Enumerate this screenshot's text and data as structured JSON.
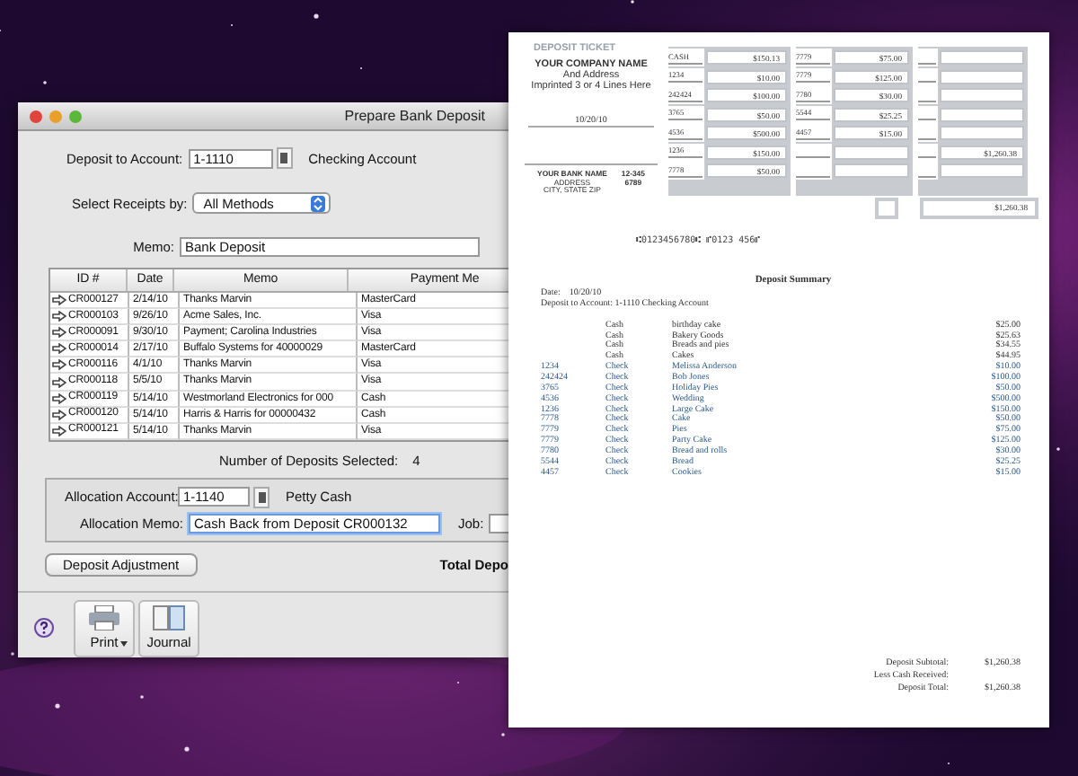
{
  "window": {
    "title": "Prepare Bank Deposit"
  },
  "deposit_to": {
    "label": "Deposit to Account:",
    "value": "1-1110",
    "account_name": "Checking Account"
  },
  "select_receipts": {
    "label": "Select Receipts by:",
    "value": "All Methods"
  },
  "memo": {
    "label": "Memo:",
    "value": "Bank Deposit"
  },
  "table": {
    "columns": [
      "ID #",
      "Date",
      "Memo",
      "Payment Me"
    ],
    "rows": [
      {
        "id": "CR000127",
        "date": "2/14/10",
        "memo": "Thanks Marvin",
        "payment": "MasterCard"
      },
      {
        "id": "CR000103",
        "date": "9/26/10",
        "memo": "Acme Sales, Inc.",
        "payment": "Visa"
      },
      {
        "id": "CR000091",
        "date": "9/30/10",
        "memo": "Payment; Carolina Industries",
        "payment": "Visa"
      },
      {
        "id": "CR000014",
        "date": "2/17/10",
        "memo": "Buffalo Systems for 40000029",
        "payment": "MasterCard"
      },
      {
        "id": "CR000116",
        "date": "4/1/10",
        "memo": "Thanks Marvin",
        "payment": "Visa"
      },
      {
        "id": "CR000118",
        "date": "5/5/10",
        "memo": "Thanks Marvin",
        "payment": "Visa"
      },
      {
        "id": "CR000119",
        "date": "5/14/10",
        "memo": "Westmorland Electronics for 000",
        "payment": "Cash"
      },
      {
        "id": "CR000120",
        "date": "5/14/10",
        "memo": "Harris & Harris for 00000432",
        "payment": "Cash"
      },
      {
        "id": "CR000121",
        "date": "5/14/10",
        "memo": "Thanks Marvin",
        "payment": "Visa"
      }
    ]
  },
  "deposits_selected": {
    "label": "Number of Deposits Selected:",
    "value": "4"
  },
  "allocation": {
    "account_label": "Allocation Account:",
    "account": "1-1140",
    "account_name": "Petty Cash",
    "memo_label": "Allocation Memo:",
    "memo": "Cash Back from Deposit CR000132",
    "job_label": "Job:"
  },
  "deposit_adjustment_button": "Deposit Adjustment",
  "total_label": "Total Depo",
  "toolbar": [
    {
      "label": "Print",
      "kind": "print"
    },
    {
      "label": "Journal",
      "kind": "journal"
    }
  ],
  "ticket": {
    "title": "DEPOSIT TICKET",
    "company": [
      "YOUR COMPANY NAME",
      "And Address",
      "Imprinted 3 or 4 Lines Here"
    ],
    "date": "10/20/10",
    "bank": [
      "YOUR BANK NAME",
      "ADDRESS",
      "CITY, STATE ZIP"
    ],
    "routing": [
      "12-345",
      "6789"
    ],
    "columns": [
      [
        {
          "ref": "CASH",
          "amount": "$150.13"
        },
        {
          "ref": "1234",
          "amount": "$10.00"
        },
        {
          "ref": "242424",
          "amount": "$100.00"
        },
        {
          "ref": "3765",
          "amount": "$50.00"
        },
        {
          "ref": "4536",
          "amount": "$500.00"
        },
        {
          "ref": "1236",
          "amount": "$150.00"
        },
        {
          "ref": "7778",
          "amount": "$50.00"
        }
      ],
      [
        {
          "ref": "7779",
          "amount": "$75.00"
        },
        {
          "ref": "7779",
          "amount": "$125.00"
        },
        {
          "ref": "7780",
          "amount": "$30.00"
        },
        {
          "ref": "5544",
          "amount": "$25.25"
        },
        {
          "ref": "4457",
          "amount": "$15.00"
        }
      ]
    ],
    "subtotal": "$1,260.38",
    "total": "$1,260.38",
    "micr": "⑆0123456780⑆ ⑈0123 456⑈"
  },
  "summary": {
    "title": "Deposit Summary",
    "date_label": "Date:",
    "date": "10/20/10",
    "account_line": "Deposit to Account: 1-1110  Checking Account",
    "rows": [
      {
        "kind": "cash",
        "type": "Cash",
        "memo": "birthday cake",
        "amount": "$25.00"
      },
      {
        "kind": "cash",
        "type": "Cash",
        "memo": "Bakery Goods",
        "amount": "$25.63"
      },
      {
        "kind": "cash",
        "type": "Cash",
        "memo": "Breads and pies",
        "amount": "$34.55"
      },
      {
        "kind": "cash",
        "type": "Cash",
        "memo": "Cakes",
        "amount": "$44.95"
      },
      {
        "kind": "check",
        "ref": "1234",
        "type": "Check",
        "memo": "Melissa Anderson",
        "amount": "$10.00"
      },
      {
        "kind": "check",
        "ref": "242424",
        "type": "Check",
        "memo": "Bob Jones",
        "amount": "$100.00"
      },
      {
        "kind": "check",
        "ref": "3765",
        "type": "Check",
        "memo": "Holiday Pies",
        "amount": "$50.00"
      },
      {
        "kind": "check",
        "ref": "4536",
        "type": "Check",
        "memo": "Wedding",
        "amount": "$500.00"
      },
      {
        "kind": "check",
        "ref": "1236",
        "type": "Check",
        "memo": "Large Cake",
        "amount": "$150.00"
      },
      {
        "kind": "check",
        "ref": "7778",
        "type": "Check",
        "memo": "Cake",
        "amount": "$50.00"
      },
      {
        "kind": "check",
        "ref": "7779",
        "type": "Check",
        "memo": "Pies",
        "amount": "$75.00"
      },
      {
        "kind": "check",
        "ref": "7779",
        "type": "Check",
        "memo": "Party Cake",
        "amount": "$125.00"
      },
      {
        "kind": "check",
        "ref": "7780",
        "type": "Check",
        "memo": "Bread and rolls",
        "amount": "$30.00"
      },
      {
        "kind": "check",
        "ref": "5544",
        "type": "Check",
        "memo": "Bread",
        "amount": "$25.25"
      },
      {
        "kind": "check",
        "ref": "4457",
        "type": "Check",
        "memo": "Cookies",
        "amount": "$15.00"
      }
    ],
    "totals": [
      {
        "label": "Deposit Subtotal:",
        "value": "$1,260.38"
      },
      {
        "label": "Less Cash Received:"
      },
      {
        "label": "Deposit Total:",
        "value": "$1,260.38"
      }
    ]
  }
}
